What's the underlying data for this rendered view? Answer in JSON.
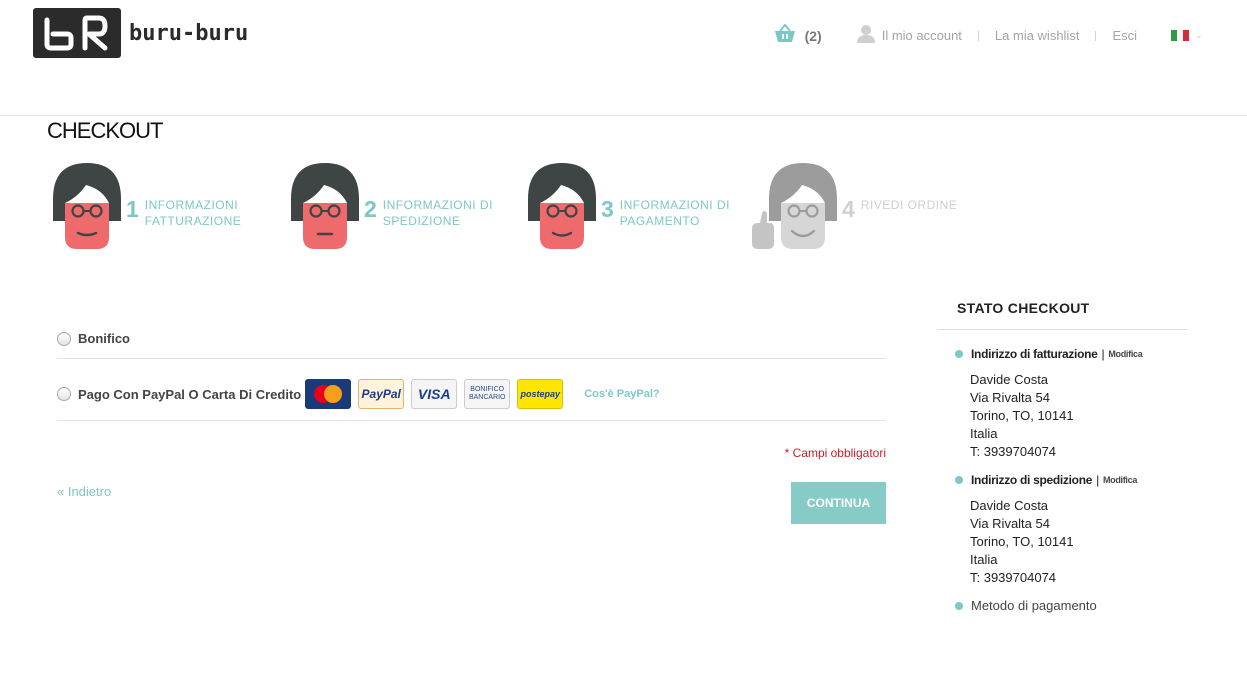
{
  "header": {
    "logo_text": "buru-buru",
    "cart_count": "(2)",
    "account_label": "Il mio account",
    "wishlist_label": "La mia wishlist",
    "logout_label": "Esci",
    "language": "it"
  },
  "page": {
    "title": "CHECKOUT"
  },
  "steps": [
    {
      "number": "1",
      "line1": "INFORMAZIONI",
      "line2": "FATTURAZIONE",
      "state": "done"
    },
    {
      "number": "2",
      "line1": "INFORMAZIONI DI",
      "line2": "SPEDIZIONE",
      "state": "done"
    },
    {
      "number": "3",
      "line1": "INFORMAZIONI DI",
      "line2": "PAGAMENTO",
      "state": "done"
    },
    {
      "number": "4",
      "line1": "RIVEDI ORDINE",
      "line2": "",
      "state": "inactive"
    }
  ],
  "payment": {
    "methods": [
      {
        "label": "Bonifico"
      },
      {
        "label": "Pago Con PayPal O Carta Di Credito"
      }
    ],
    "logos": [
      "MasterCard",
      "PayPal",
      "VISA",
      "BONIFICO BANCARIO",
      "postepay"
    ],
    "what_is_paypal": "Cos'è PayPal?"
  },
  "form": {
    "required_note": "* Campi obbligatori",
    "back_label": "« Indietro",
    "continue_label": "CONTINUA"
  },
  "sidebar": {
    "title": "STATO CHECKOUT",
    "billing": {
      "heading": "Indirizzo di fatturazione",
      "separator": "|",
      "edit": "Modifica",
      "name": "Davide Costa",
      "street": "Via Rivalta 54",
      "city": "Torino, TO, 10141",
      "country": "Italia",
      "phone": "T: 3939704074"
    },
    "shipping": {
      "heading": "Indirizzo di spedizione",
      "separator": "|",
      "edit": "Modifica",
      "name": "Davide Costa",
      "street": "Via Rivalta 54",
      "city": "Torino, TO, 10141",
      "country": "Italia",
      "phone": "T: 3939704074"
    },
    "payment_method": "Metodo di pagamento"
  },
  "colors": {
    "accent": "#7cc8c4",
    "button": "#86cbc6",
    "required": "#c8202a",
    "face": "#ee6a6c",
    "hair": "#3f4444"
  }
}
